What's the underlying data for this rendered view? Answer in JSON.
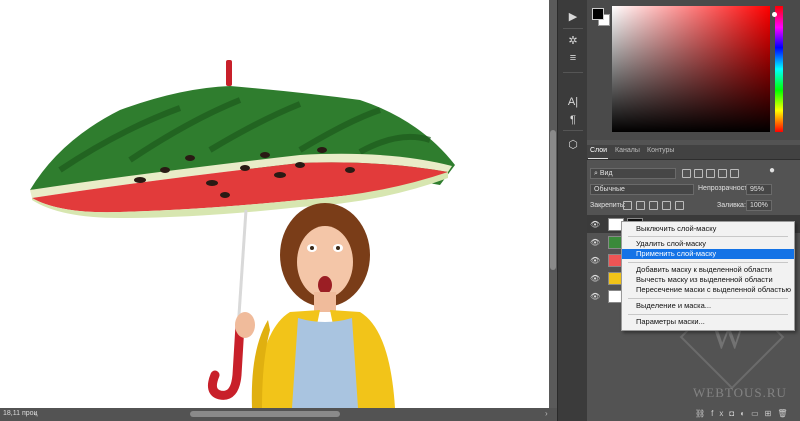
{
  "statusbar": {
    "zoom": "18,11 проц",
    "left_arrow": "‹",
    "right_arrow": "›"
  },
  "colors": {
    "foreground": "#000000",
    "background": "#ffffff",
    "picker_hue": "#ff0000",
    "menu_highlight": "#1473e6"
  },
  "tools": [
    "play-icon",
    "brush-settings-icon",
    "properties-icon",
    "paragraph-text-icon",
    "paragraph-mark-icon",
    "3d-cube-icon"
  ],
  "layers_panel": {
    "tabs": [
      "Слои",
      "Каналы",
      "Контуры"
    ],
    "filter_kind": "Вид",
    "blend_mode": "Обычные",
    "opacity_label": "Непрозрачность:",
    "opacity_value": "95%",
    "lock_label": "Закрепить:",
    "fill_label": "Заливка:",
    "fill_value": "100%"
  },
  "context_menu": {
    "items": [
      "Выключить слой-маску",
      "Удалить слой-маску",
      "Применить слой-маску",
      "Добавить маску к выделенной области",
      "Вычесть маску из выделенной области",
      "Пересечение маски с выделенной областью",
      "Выделение и маска...",
      "Параметры маски..."
    ],
    "highlighted_index": 2
  },
  "watermark": {
    "text": "WEBTOUS.RU",
    "logo": "W"
  },
  "bottom_bar_icons": [
    "link-icon",
    "fx-icon",
    "mask-icon",
    "adjustment-icon",
    "folder-icon",
    "new-layer-icon",
    "trash-icon"
  ]
}
